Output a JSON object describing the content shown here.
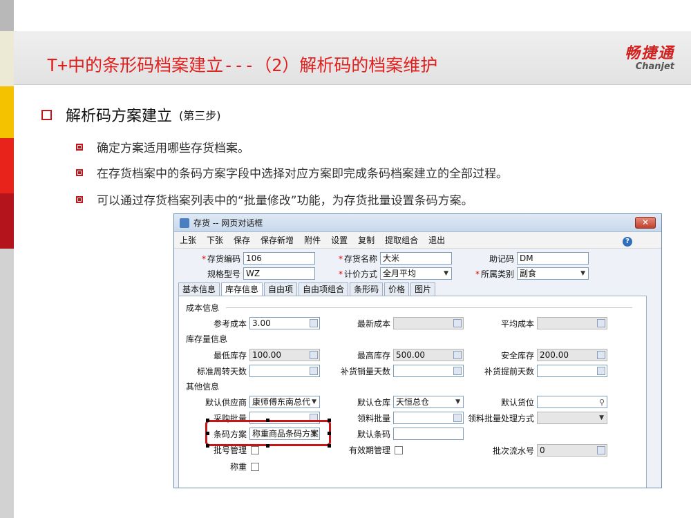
{
  "slide": {
    "title": "T+中的条形码档案建立---（2）解析码的档案维护",
    "logo_cn": "畅捷通",
    "logo_en": "Chanjet",
    "heading": "解析码方案建立",
    "heading_sub": "(第三步)",
    "bullets": [
      "确定方案适用哪些存货档案。",
      "在存货档案中的条码方案字段中选择对应方案即完成条码档案建立的全部过程。",
      "可以通过存货档案列表中的“批量修改”功能，为存货批量设置条码方案。"
    ]
  },
  "dialog": {
    "title": "存货 -- 网页对话框",
    "close": "✕",
    "toolbar": [
      "上张",
      "下张",
      "保存",
      "保存新增",
      "附件",
      "设置",
      "复制",
      "提取组合",
      "退出"
    ],
    "help": "?",
    "header": {
      "code_label": "存货编码",
      "code_value": "106",
      "name_label": "存货名称",
      "name_value": "大米",
      "mnemonic_label": "助记码",
      "mnemonic_value": "DM",
      "spec_label": "规格型号",
      "spec_value": "WZ",
      "pricing_label": "计价方式",
      "pricing_value": "全月平均",
      "category_label": "所属类别",
      "category_value": "副食"
    },
    "tabs": [
      "基本信息",
      "库存信息",
      "自由项",
      "自由项组合",
      "条形码",
      "价格",
      "图片"
    ],
    "sections": {
      "cost": "成本信息",
      "stock": "库存量信息",
      "other": "其他信息"
    },
    "fields": {
      "ref_cost_label": "参考成本",
      "ref_cost_value": "3.00",
      "latest_cost_label": "最新成本",
      "avg_cost_label": "平均成本",
      "min_stock_label": "最低库存",
      "min_stock_value": "100.00",
      "max_stock_label": "最高库存",
      "max_stock_value": "500.00",
      "safe_stock_label": "安全库存",
      "safe_stock_value": "200.00",
      "turnover_label": "标准周转天数",
      "replenish_days_label": "补货销量天数",
      "lead_days_label": "补货提前天数",
      "supplier_label": "默认供应商",
      "supplier_value": "康师傅东南总代",
      "warehouse_label": "默认仓库",
      "warehouse_value": "天恒总仓",
      "location_label": "默认货位",
      "purchase_batch_label": "采购批量",
      "pick_batch_label": "领料批量",
      "pick_method_label": "领料批量处理方式",
      "barcode_scheme_label": "条码方案",
      "barcode_scheme_value": "称重商品条码方案",
      "default_barcode_label": "默认条码",
      "batch_mgmt_label": "批号管理",
      "expiry_mgmt_label": "有效期管理",
      "batch_serial_label": "批次流水号",
      "batch_serial_value": "0",
      "weigh_label": "称重"
    }
  }
}
